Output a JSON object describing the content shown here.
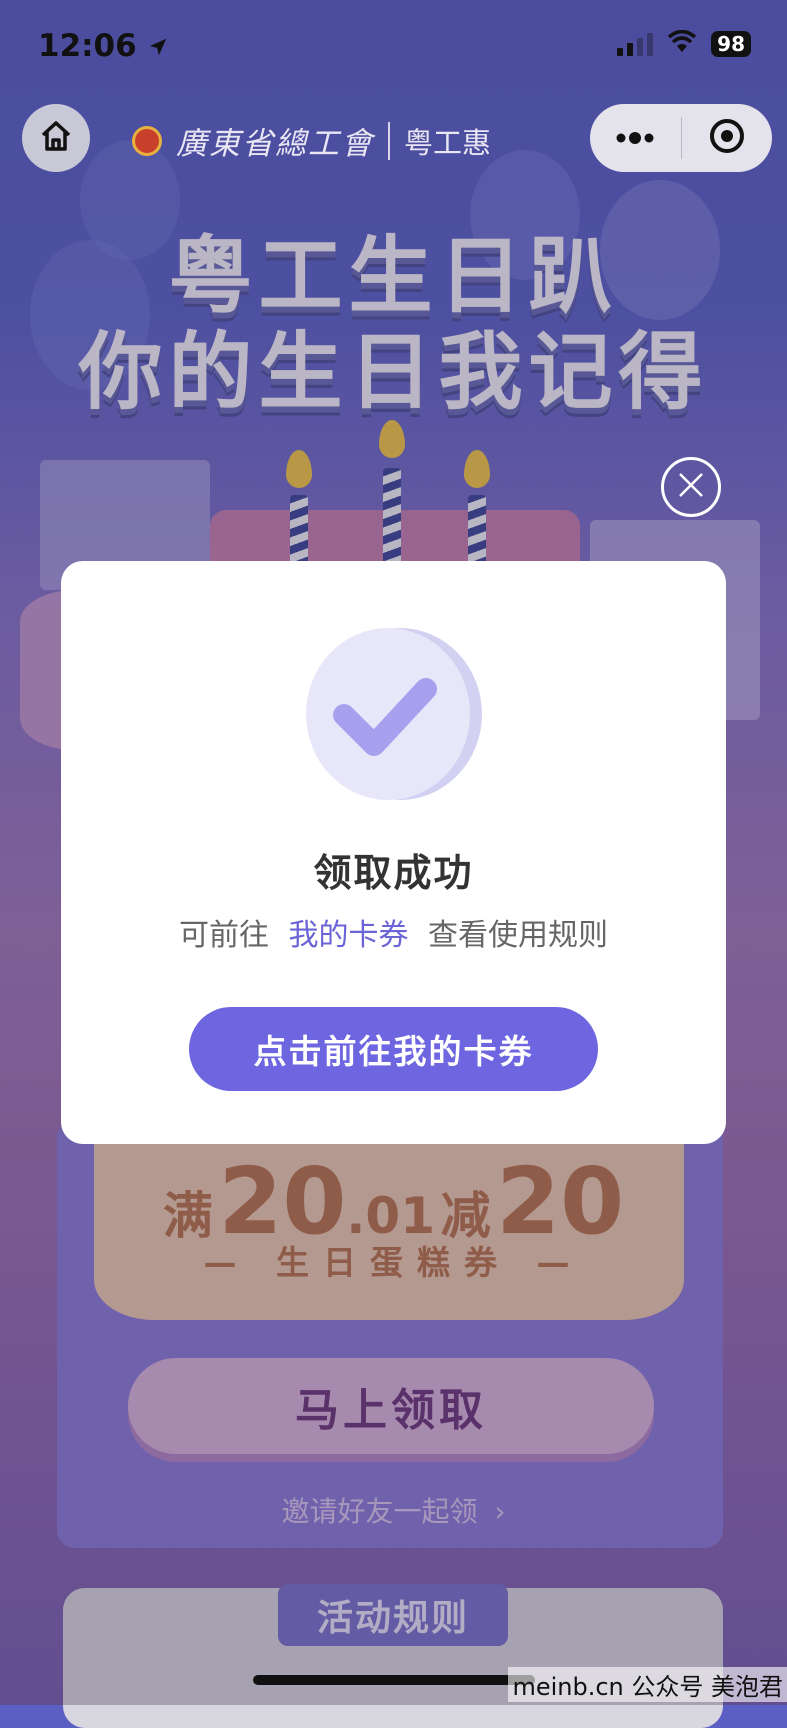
{
  "status_bar": {
    "time": "12:06",
    "battery": "98"
  },
  "nav": {
    "brand_org": "廣東省總工會",
    "brand_name": "粤工惠"
  },
  "hero": {
    "line1": "粤工生日趴",
    "line2": "你的生日我记得"
  },
  "coupon": {
    "prefix": "满",
    "threshold_int": "20",
    "threshold_dec": ".01",
    "mid": "减",
    "discount": "20",
    "label": "— 生日蛋糕券 —",
    "claim_button": "马上领取",
    "invite": "邀请好友一起领"
  },
  "rules": {
    "tab_label": "活动规则"
  },
  "modal": {
    "title": "领取成功",
    "desc_before": "可前往",
    "desc_link": "我的卡券",
    "desc_after": "查看使用规则",
    "button": "点击前往我的卡券"
  },
  "watermark": "meinb.cn 公众号 美泡君",
  "colors": {
    "accent": "#6e66e0",
    "link": "#6b64d6",
    "coupon_text": "#b8754f"
  }
}
